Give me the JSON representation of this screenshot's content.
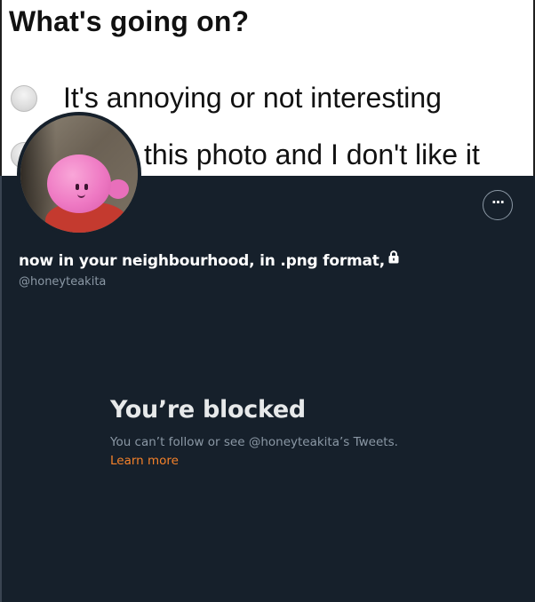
{
  "banner": {
    "title": "What's going on?",
    "options": [
      {
        "label": "It's annoying or not interesting",
        "selected": false
      },
      {
        "label": "this photo and I don't like it",
        "selected": false
      }
    ]
  },
  "profile": {
    "display_name": "now in your neighbourhood, in .png format,",
    "handle": "@honeyteakita",
    "protected": true,
    "more_icon": "ellipsis-icon",
    "more_label": "···"
  },
  "blocked": {
    "title": "You’re blocked",
    "description": "You can’t follow or see @honeyteakita’s Tweets.",
    "link_label": "Learn more"
  },
  "colors": {
    "background": "#16202b",
    "text_primary": "#e7e9ea",
    "text_secondary": "#8b98a5",
    "link": "#f4812a"
  }
}
